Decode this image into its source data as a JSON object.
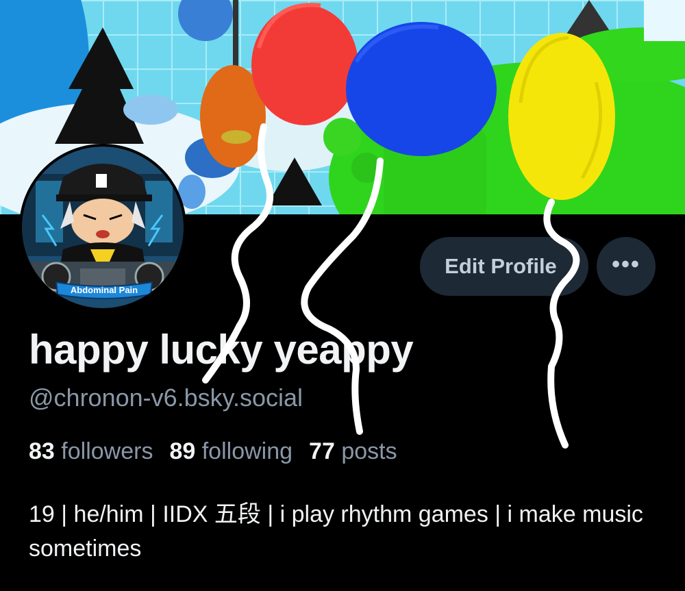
{
  "profile": {
    "display_name": "happy lucky yeappy",
    "handle": "@chronon-v6.bsky.social",
    "avatar_caption": "Abdominal Pain",
    "stats": {
      "followers_count": "83",
      "followers_label": "followers",
      "following_count": "89",
      "following_label": "following",
      "posts_count": "77",
      "posts_label": "posts"
    },
    "bio": "19 | he/him | IIDX 五段 | i play rhythm games | i make music sometimes"
  },
  "actions": {
    "edit_label": "Edit Profile",
    "more_label": "•••"
  },
  "drawing": {
    "balloon_colors": [
      "#f23b37",
      "#1746e8",
      "#f5e60a"
    ]
  },
  "colors": {
    "background": "#000000",
    "button_bg": "#1e2936",
    "muted_text": "#8a98a8"
  }
}
